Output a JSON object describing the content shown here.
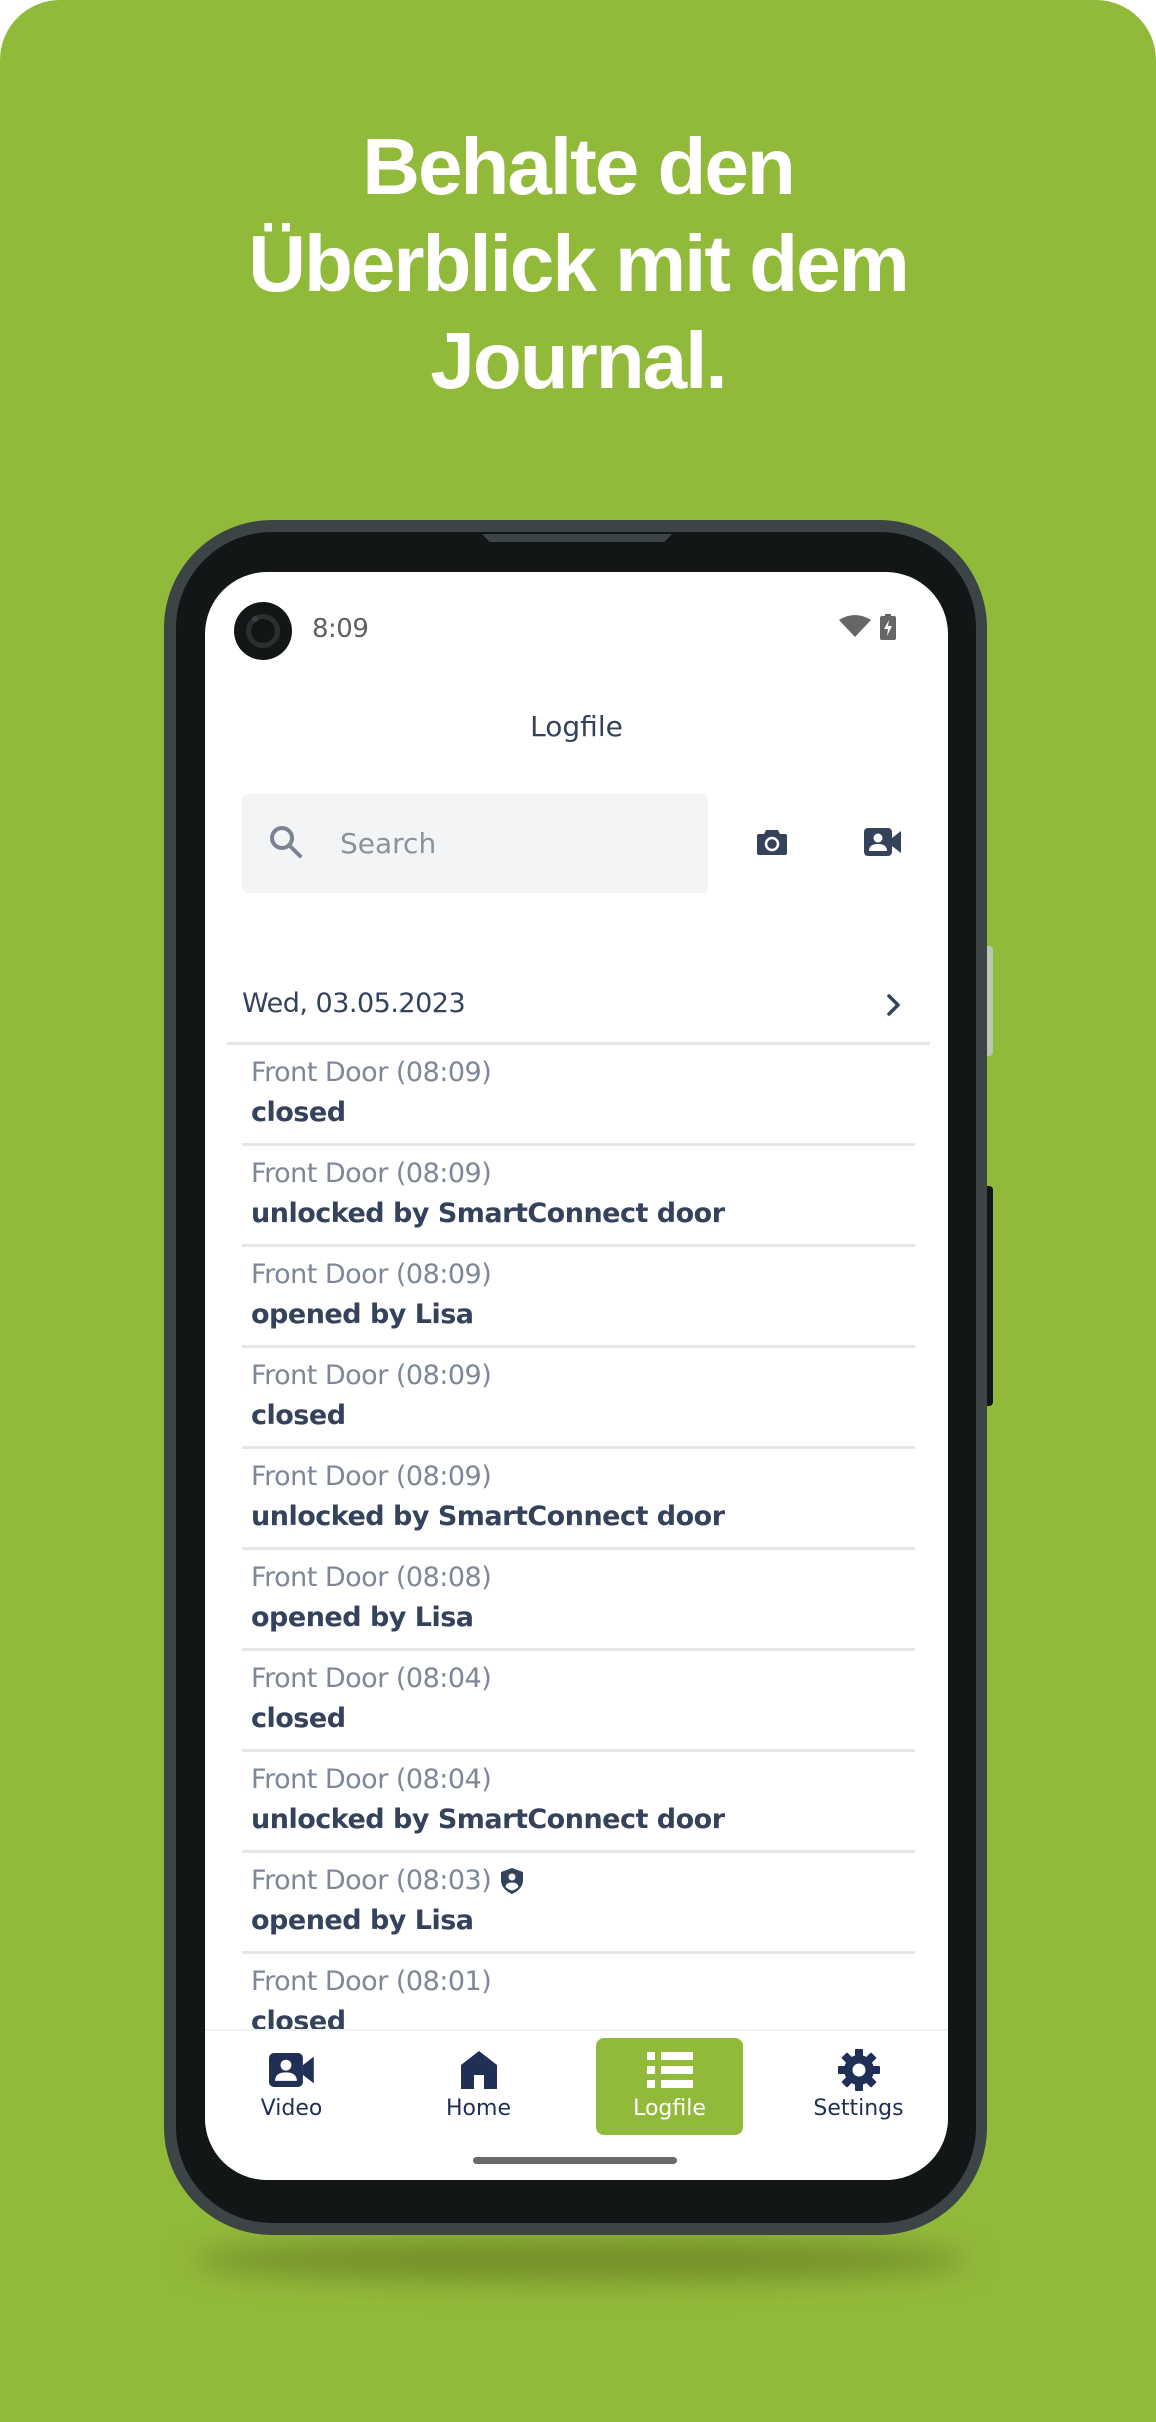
{
  "headline": {
    "lines": [
      "Behalte den",
      "Überblick mit dem",
      "Journal."
    ]
  },
  "status_bar": {
    "time": "8:09",
    "icons": [
      "wifi-icon",
      "battery-charging-icon"
    ]
  },
  "app": {
    "title": "Logfile",
    "search": {
      "placeholder": "Search",
      "value": ""
    },
    "actions": [
      {
        "name": "camera-icon",
        "label": "Snapshot"
      },
      {
        "name": "video-user-icon",
        "label": "Video"
      }
    ],
    "date_header": {
      "date": "Wed, 03.05.2023",
      "icon": "chevron-right-icon"
    },
    "entries": [
      {
        "title": "Front Door (08:09)",
        "action": "closed",
        "badge": null
      },
      {
        "title": "Front Door (08:09)",
        "action": "unlocked by SmartConnect door",
        "badge": null
      },
      {
        "title": "Front Door (08:09)",
        "action": "opened by Lisa",
        "badge": null
      },
      {
        "title": "Front Door (08:09)",
        "action": "closed",
        "badge": null
      },
      {
        "title": "Front Door (08:09)",
        "action": "unlocked by SmartConnect door",
        "badge": null
      },
      {
        "title": "Front Door (08:08)",
        "action": "opened by Lisa",
        "badge": null
      },
      {
        "title": "Front Door (08:04)",
        "action": "closed",
        "badge": null
      },
      {
        "title": "Front Door (08:04)",
        "action": "unlocked by SmartConnect door",
        "badge": null
      },
      {
        "title": "Front Door (08:03)",
        "action": "opened by Lisa",
        "badge": "shield-user-icon"
      },
      {
        "title": "Front Door (08:01)",
        "action": "closed",
        "badge": null
      }
    ],
    "nav": [
      {
        "label": "Video",
        "icon": "video-user-icon",
        "active": false
      },
      {
        "label": "Home",
        "icon": "home-icon",
        "active": false
      },
      {
        "label": "Logfile",
        "icon": "list-icon",
        "active": true
      },
      {
        "label": "Settings",
        "icon": "gear-icon",
        "active": false
      }
    ]
  },
  "colors": {
    "brand_green": "#92ba3a",
    "navy": "#34425c",
    "nav_navy": "#1f2f55",
    "muted_text": "#7d8797"
  }
}
